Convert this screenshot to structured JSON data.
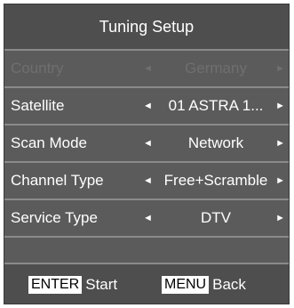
{
  "title": "Tuning Setup",
  "rows": [
    {
      "label": "Country",
      "value": "Germany",
      "enabled": false
    },
    {
      "label": "Satellite",
      "value": "01 ASTRA 1...",
      "enabled": true
    },
    {
      "label": "Scan Mode",
      "value": "Network",
      "enabled": true
    },
    {
      "label": "Channel Type",
      "value": "Free+Scramble",
      "enabled": true
    },
    {
      "label": "Service Type",
      "value": "DTV",
      "enabled": true
    }
  ],
  "arrows": {
    "left": "◄",
    "right": "►"
  },
  "footer": {
    "enter_key": "ENTER",
    "enter_action": "Start",
    "menu_key": "MENU",
    "menu_action": "Back"
  },
  "colors": {
    "panel": "#5b5b5b",
    "header": "#4e4e4e",
    "divider": "#8a8a8a",
    "text": "#ffffff",
    "disabled_text": "#6f6f6f"
  }
}
